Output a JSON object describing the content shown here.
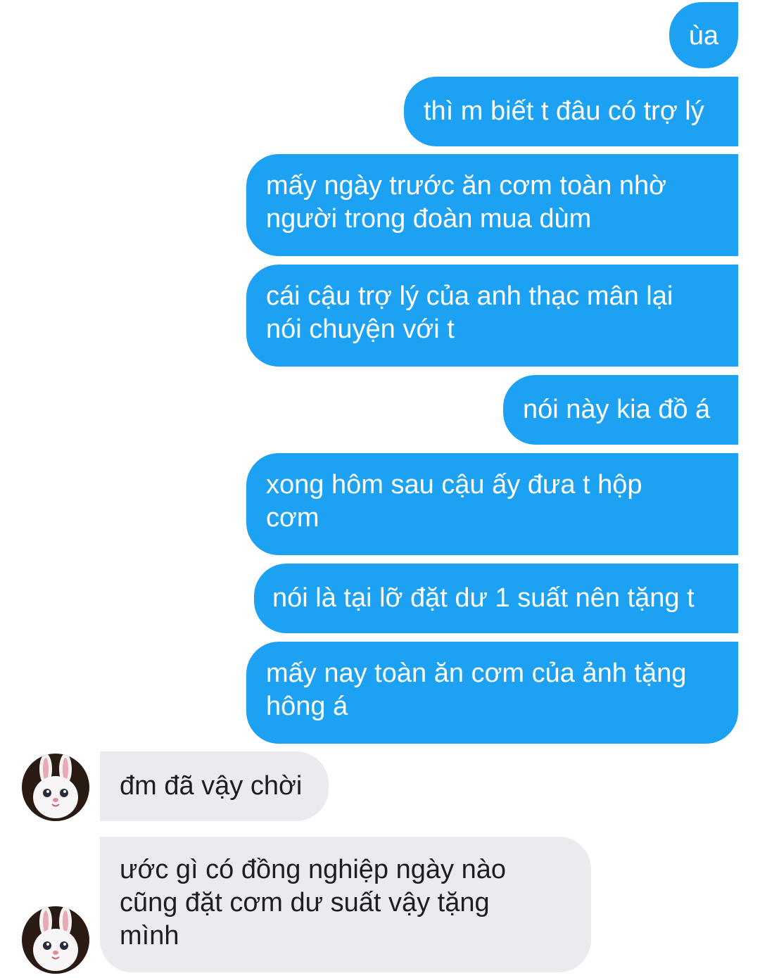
{
  "conversation": {
    "colors": {
      "outgoing_bubble": "#1da1f2",
      "outgoing_text": "#ffffff",
      "incoming_bubble": "#e9ebee",
      "incoming_text": "#1c1e21"
    },
    "avatar_icon": "bunny-avatar-icon",
    "messages": [
      {
        "dir": "out",
        "text": "ùa"
      },
      {
        "dir": "out",
        "text": "thì m biết t đâu có trợ lý"
      },
      {
        "dir": "out",
        "text": "mấy ngày trước ăn cơm toàn nhờ\nngười trong đoàn mua dùm"
      },
      {
        "dir": "out",
        "text": "cái cậu trợ lý của anh thạc mân lại\nnói chuyện với t"
      },
      {
        "dir": "out",
        "text": "nói này kia đồ á"
      },
      {
        "dir": "out",
        "text": "xong hôm sau cậu ấy đưa t hộp\ncơm"
      },
      {
        "dir": "out",
        "text": "nói là tại lỡ đặt dư 1 suất nên tặng t"
      },
      {
        "dir": "out",
        "text": "mấy nay toàn ăn cơm của ảnh tặng\nhông á"
      },
      {
        "dir": "in",
        "text": "đm đã vậy chời"
      },
      {
        "dir": "in",
        "text": "ước gì có đồng nghiệp ngày nào\ncũng đặt cơm dư suất vậy tặng\nmình"
      }
    ]
  }
}
